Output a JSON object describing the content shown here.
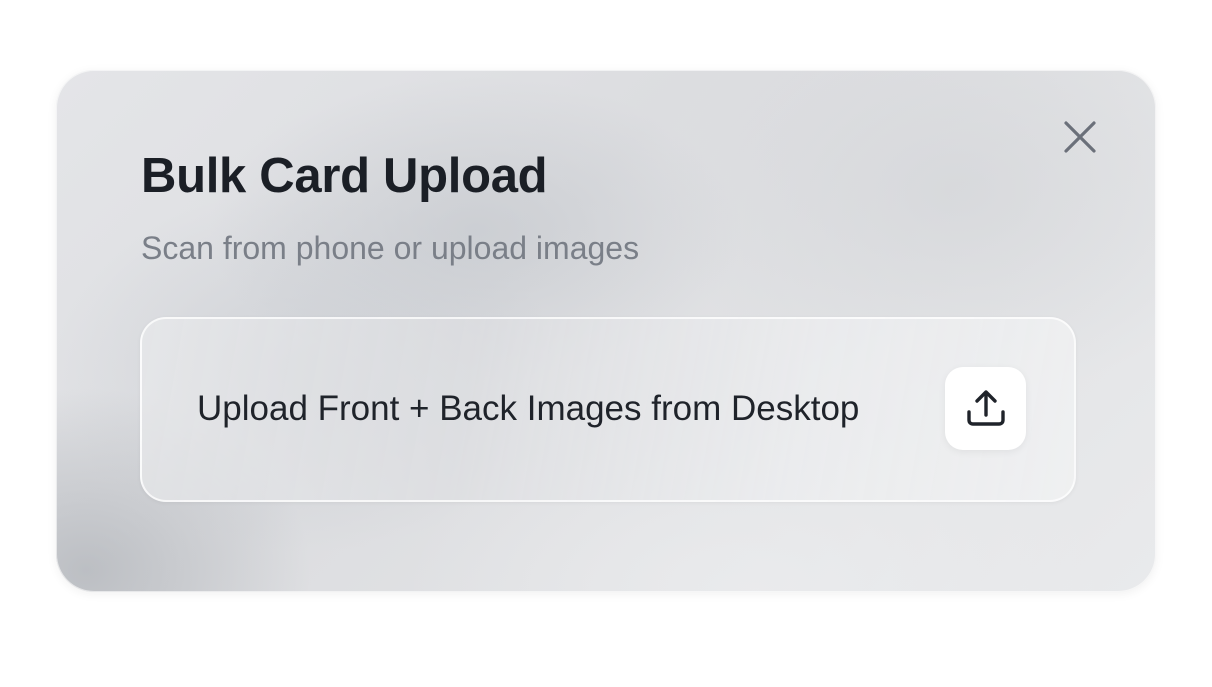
{
  "dialog": {
    "title": "Bulk Card Upload",
    "subtitle": "Scan from phone or upload images",
    "close_icon": "close-icon",
    "upload_option": {
      "label": "Upload Front + Back Images from Desktop",
      "icon": "upload-icon"
    }
  },
  "colors": {
    "title": "#1b1f26",
    "subtitle": "#7a7f88",
    "icon": "#1f232a",
    "close": "#6b707a"
  }
}
